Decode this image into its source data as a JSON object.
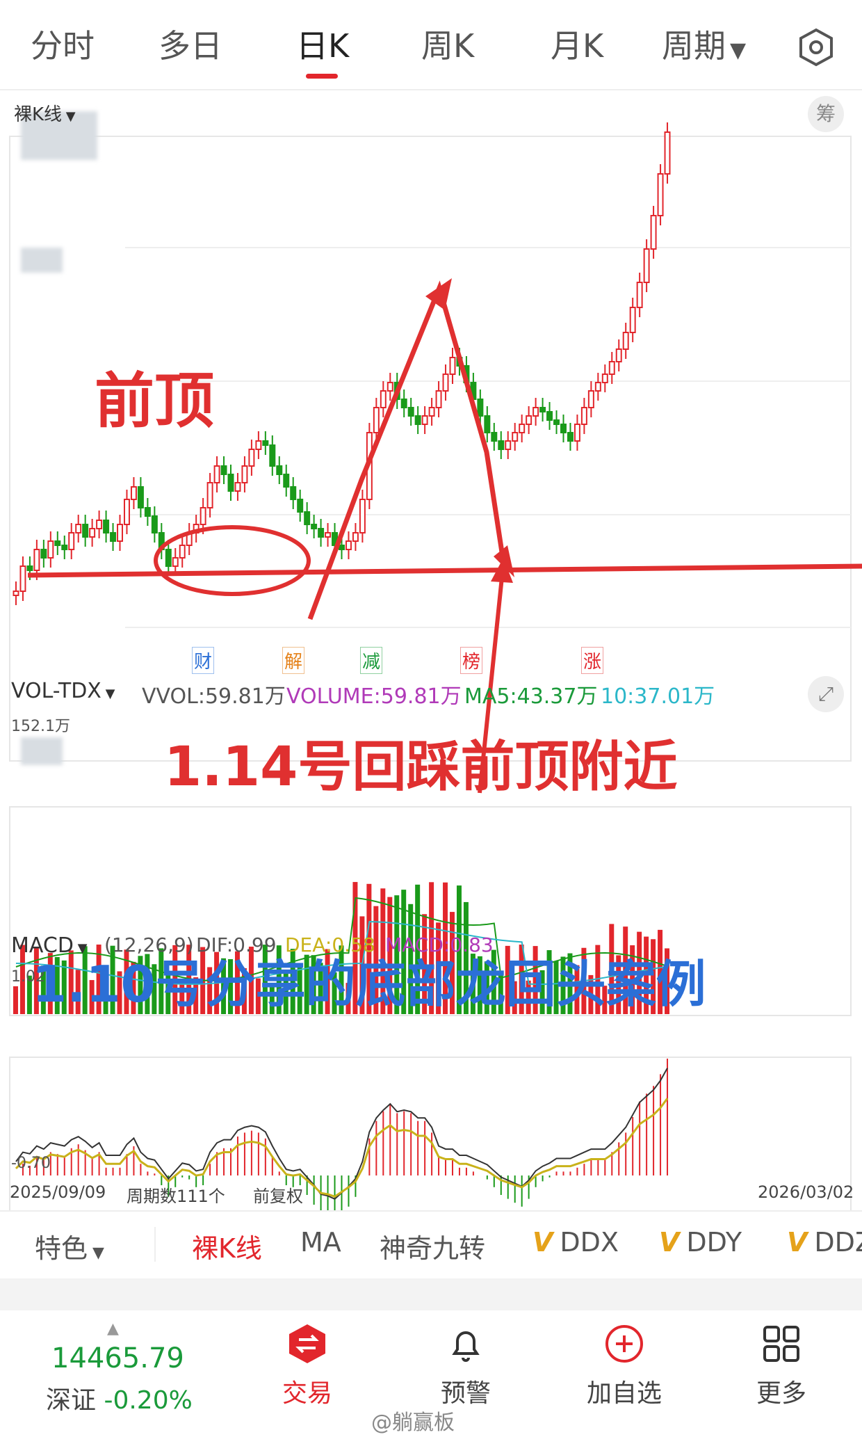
{
  "tabs": [
    {
      "label": "分时"
    },
    {
      "label": "多日"
    },
    {
      "label": "日K",
      "active": true
    },
    {
      "label": "周K"
    },
    {
      "label": "月K"
    },
    {
      "label": "周期"
    }
  ],
  "settings_icon": "hexagon-gear-icon",
  "kline": {
    "mode_label": "裸K线",
    "chip_label": "筹",
    "event_tags": [
      "财",
      "解",
      "减",
      "榜",
      "涨"
    ],
    "grid_on": true
  },
  "volume": {
    "indicator": "VOL-TDX",
    "vvol": "VVOL:59.81万",
    "volume": "VOLUME:59.81万",
    "ma5": "MA5:43.37万",
    "ma10": "10:37.01万",
    "max_label": "152.1万"
  },
  "macd": {
    "indicator": "MACD",
    "params": "(12,26,9)",
    "dif": "DIF:0.99",
    "dea": "DEA:0.58",
    "macd": "MACD:0.83",
    "max_label": "1.02",
    "min_label": "-0.70"
  },
  "footer_axis": {
    "start_date": "2025/09/09",
    "period_count": "周期数111个",
    "adjust": "前复权",
    "end_date": "2026/03/02"
  },
  "annotations": {
    "prev_top": "前顶",
    "retest": "1.14号回踩前顶附近",
    "case": "1.10号分享的底部龙回头案例"
  },
  "colors": {
    "up": "#e2262c",
    "down": "#1a9a1a",
    "annotation_red": "#e03030",
    "annotation_blue": "#2b6fd6",
    "ma_black": "#333333",
    "ma_yellow": "#c9b21a",
    "ma_cyan": "#2bb7c9"
  },
  "toolbar": {
    "feature": "特色",
    "items": [
      "裸K线",
      "MA",
      "神奇九转",
      "DDX",
      "DDY",
      "DDZ"
    ],
    "active": "裸K线"
  },
  "bottom_nav": {
    "index_value": "14465.79",
    "index_name": "深证",
    "index_change": "-0.20%",
    "trade": "交易",
    "alert": "预警",
    "add_watch": "加自选",
    "more": "更多"
  },
  "watermark": "@躺赢板",
  "chart_data": {
    "type": "candlestick",
    "x_start": "2025/09/09",
    "x_end": "2026/03/02",
    "bars": 111,
    "price_path": [
      0.3,
      0.36,
      0.35,
      0.4,
      0.38,
      0.42,
      0.41,
      0.4,
      0.44,
      0.46,
      0.43,
      0.45,
      0.47,
      0.44,
      0.42,
      0.46,
      0.52,
      0.55,
      0.5,
      0.48,
      0.44,
      0.4,
      0.36,
      0.38,
      0.41,
      0.44,
      0.46,
      0.5,
      0.56,
      0.6,
      0.58,
      0.54,
      0.56,
      0.6,
      0.64,
      0.66,
      0.65,
      0.6,
      0.58,
      0.55,
      0.52,
      0.49,
      0.46,
      0.45,
      0.43,
      0.44,
      0.41,
      0.4,
      0.42,
      0.44,
      0.52,
      0.68,
      0.74,
      0.78,
      0.8,
      0.76,
      0.74,
      0.72,
      0.7,
      0.72,
      0.74,
      0.78,
      0.82,
      0.86,
      0.84,
      0.8,
      0.76,
      0.72,
      0.68,
      0.66,
      0.64,
      0.66,
      0.68,
      0.7,
      0.72,
      0.74,
      0.73,
      0.71,
      0.7,
      0.68,
      0.66,
      0.7,
      0.74,
      0.78,
      0.8,
      0.82,
      0.85,
      0.88,
      0.92,
      0.98,
      1.04,
      1.12,
      1.2,
      1.3,
      1.4
    ]
  }
}
